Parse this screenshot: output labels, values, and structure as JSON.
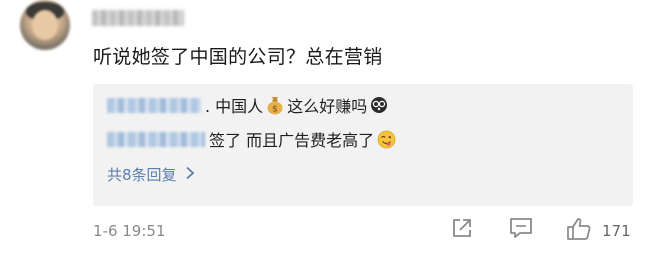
{
  "comment": {
    "text": "听说她签了中国的公司？总在营销",
    "timestamp": "1-6 19:51",
    "like_count": "171"
  },
  "replies": [
    {
      "text_before": ". 中国人",
      "emoji": "money-bag-icon",
      "text_after": " 这么好赚吗",
      "end_emoji": "dizzy-face-icon"
    },
    {
      "text_before": "签了 而且广告费老高了",
      "end_emoji": "wink-tongue-icon"
    }
  ],
  "more_replies": "共8条回复",
  "icons": [
    "share-icon",
    "comment-icon",
    "like-icon",
    "chevron-right-icon"
  ],
  "colors": {
    "link": "#5a7fae",
    "meta": "#8a8a8a",
    "panel": "#f2f2f2"
  }
}
